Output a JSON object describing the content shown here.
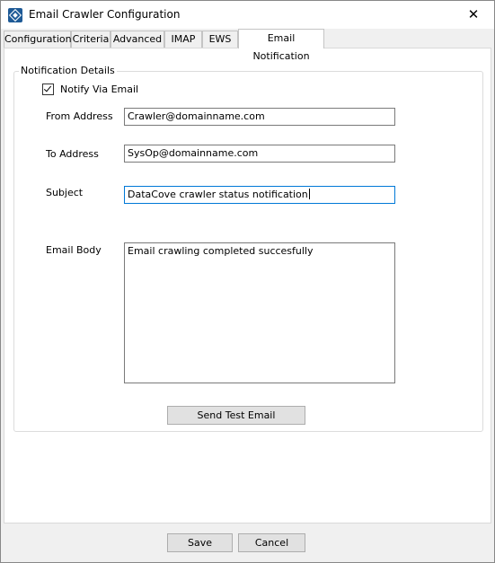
{
  "window": {
    "title": "Email Crawler Configuration",
    "close_label": "✕"
  },
  "tabs": [
    {
      "label": "Configuration"
    },
    {
      "label": "Criteria"
    },
    {
      "label": "Advanced"
    },
    {
      "label": "IMAP"
    },
    {
      "label": "EWS"
    },
    {
      "label": "Email Notification",
      "active": true
    }
  ],
  "notification": {
    "group_label": "Notification Details",
    "notify_via_email": {
      "label": "Notify Via Email",
      "checked": true
    },
    "from_address": {
      "label": "From Address",
      "value": "Crawler@domainname.com"
    },
    "to_address": {
      "label": "To Address",
      "value": "SysOp@domainname.com"
    },
    "subject": {
      "label": "Subject",
      "value": "DataCove crawler status notification"
    },
    "email_body": {
      "label": "Email Body",
      "value": "Email crawling completed succesfully"
    },
    "send_test_label": "Send Test Email"
  },
  "footer": {
    "save_label": "Save",
    "cancel_label": "Cancel"
  }
}
